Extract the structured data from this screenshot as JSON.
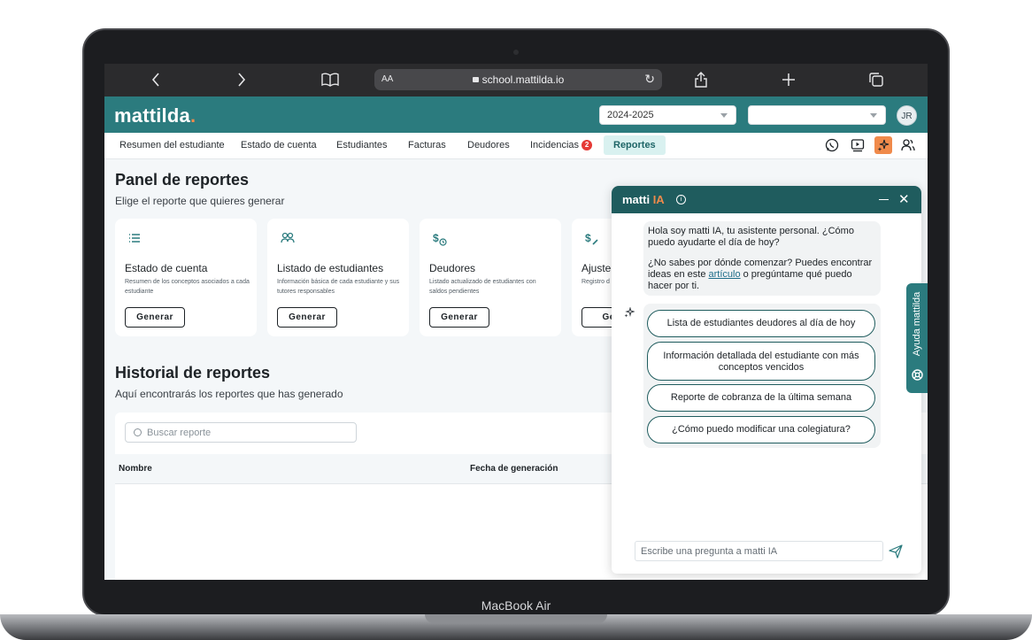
{
  "device": {
    "model": "MacBook Air"
  },
  "browser": {
    "url": "school.mattilda.io",
    "text_size": "AA"
  },
  "header": {
    "logo": "mattilda",
    "logo_dot": ".",
    "year_select": "2024-2025",
    "second_select": "",
    "user_initials": "JR"
  },
  "nav": {
    "items": [
      {
        "label": "Resumen del estudiante"
      },
      {
        "label": "Estado de cuenta"
      },
      {
        "label": "Estudiantes"
      },
      {
        "label": "Facturas"
      },
      {
        "label": "Deudores"
      },
      {
        "label": "Incidencias",
        "badge": "2"
      },
      {
        "label": "Reportes",
        "active": true
      }
    ]
  },
  "panel": {
    "title": "Panel de reportes",
    "subtitle": "Elige el reporte que quieres generar",
    "cards": [
      {
        "icon": "list-icon",
        "title": "Estado de cuenta",
        "desc": "Resumen de los conceptos asociados a cada estudiante",
        "button": "Generar"
      },
      {
        "icon": "users-icon",
        "title": "Listado de estudiantes",
        "desc": "Información básica de cada estudiante y sus tutores responsables",
        "button": "Generar"
      },
      {
        "icon": "money-clock-icon",
        "title": "Deudores",
        "desc": "Listado actualizado de estudiantes con saldos pendientes",
        "button": "Generar"
      },
      {
        "icon": "money-edit-icon",
        "title": "Ajuste",
        "desc": "Registro d aplicados",
        "button": "Gen"
      }
    ]
  },
  "history": {
    "title": "Historial de reportes",
    "subtitle": "Aquí encontrarás los reportes que has generado",
    "search_placeholder": "Buscar reporte",
    "columns": [
      "Nombre",
      "Fecha de generación"
    ]
  },
  "chat": {
    "title_main": "matti",
    "title_accent": "IA",
    "greeting": "Hola soy matti IA, tu asistente personal. ¿Cómo puedo ayudarte el día de hoy?",
    "prompt_before_link": "¿No sabes por dónde comenzar? Puedes encontrar ideas en este ",
    "link_text": "artículo",
    "prompt_after_link": " o pregúntame qué puedo hacer por ti.",
    "suggestions": [
      "Lista de estudiantes deudores al día de hoy",
      "Información detallada del estudiante con más conceptos vencidos",
      "Reporte de cobranza de la última semana",
      "¿Cómo puedo modificar una colegiatura?"
    ],
    "input_placeholder": "Escribe una pregunta a matti IA"
  },
  "help_tab": {
    "label": "Ayuda mattilda"
  },
  "colors": {
    "brand": "#2b7b7e",
    "chat_header": "#1f5c5e",
    "accent": "#f08a4b",
    "badge": "#e53935"
  }
}
